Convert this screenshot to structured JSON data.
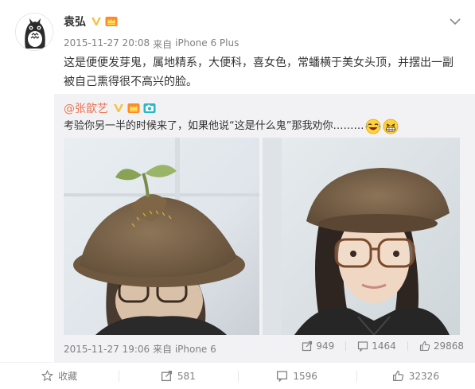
{
  "post": {
    "author": "袁弘",
    "timestamp": "2015-11-27 20:08",
    "source_prefix": "来自",
    "device": "iPhone 6 Plus",
    "text": "这是便便发芽鬼，属地精系，大便科，喜女色，常蟠横于美女头顶，并摆出一副被自己熏得很不高兴的脸。"
  },
  "repost": {
    "author": "@张歆艺",
    "text": "考验你另一半的时候来了，如果他说“这是什么鬼”那我劝你………",
    "timestamp": "2015-11-27 19:06",
    "source_prefix": "来自",
    "device": "iPhone 6",
    "repost_count": "949",
    "comment_count": "1464",
    "like_count": "29868"
  },
  "bottom_bar": {
    "favorite_label": "收藏",
    "repost_count": "581",
    "comment_count": "1596",
    "like_count": "32326"
  },
  "colors": {
    "link": "#eb7350",
    "muted": "#808080",
    "repost_bg": "#f2f2f5",
    "verified": "#f6c445"
  },
  "icons": [
    "chevron-down-icon",
    "verified-v-icon",
    "vip-crown-icon",
    "camera-icon",
    "laugh-emoji-icon",
    "grin-emoji-icon",
    "star-icon",
    "repost-icon",
    "comment-icon",
    "like-icon"
  ]
}
